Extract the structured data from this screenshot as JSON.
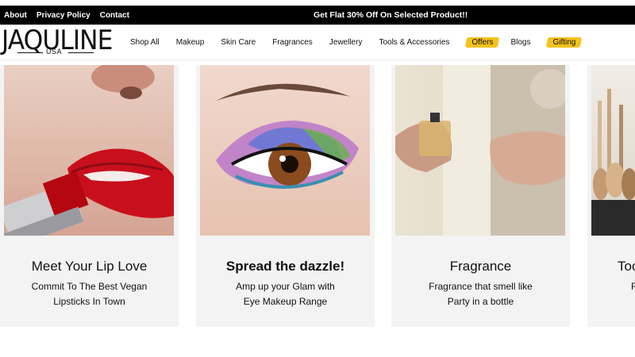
{
  "topbar": {
    "links": [
      "About",
      "Privacy Policy",
      "Contact"
    ],
    "promo": "Get Flat 30% Off On Selected Product!!"
  },
  "logo": {
    "brand": "JAQULINE",
    "sub": "USA"
  },
  "nav": {
    "items": [
      {
        "label": "Shop All",
        "highlight": false
      },
      {
        "label": "Makeup",
        "highlight": false
      },
      {
        "label": "Skin Care",
        "highlight": false
      },
      {
        "label": "Fragrances",
        "highlight": false
      },
      {
        "label": "Jewellery",
        "highlight": false
      },
      {
        "label": "Tools & Accessories",
        "highlight": false
      },
      {
        "label": "Offers",
        "highlight": true
      },
      {
        "label": "Blogs",
        "highlight": false
      },
      {
        "label": "Gifting",
        "highlight": true
      }
    ],
    "highlight_color": "#f4c21c"
  },
  "cards": [
    {
      "title": "Meet Your Lip Love",
      "desc_line1": "Commit To The Best Vegan",
      "desc_line2": "Lipsticks In Town",
      "image": "red-lipstick-lips"
    },
    {
      "title": "Spread the dazzle!",
      "desc_line1": "Amp up your Glam with",
      "desc_line2": "Eye Makeup Range",
      "image": "colorful-eye-makeup"
    },
    {
      "title": "Fragrance",
      "desc_line1": "Fragrance that smell like",
      "desc_line2": "Party in a bottle",
      "image": "perfume-spray-wrist"
    },
    {
      "title": "Too",
      "desc_line1": "F",
      "desc_line2": "",
      "image": "makeup-brushes"
    }
  ]
}
